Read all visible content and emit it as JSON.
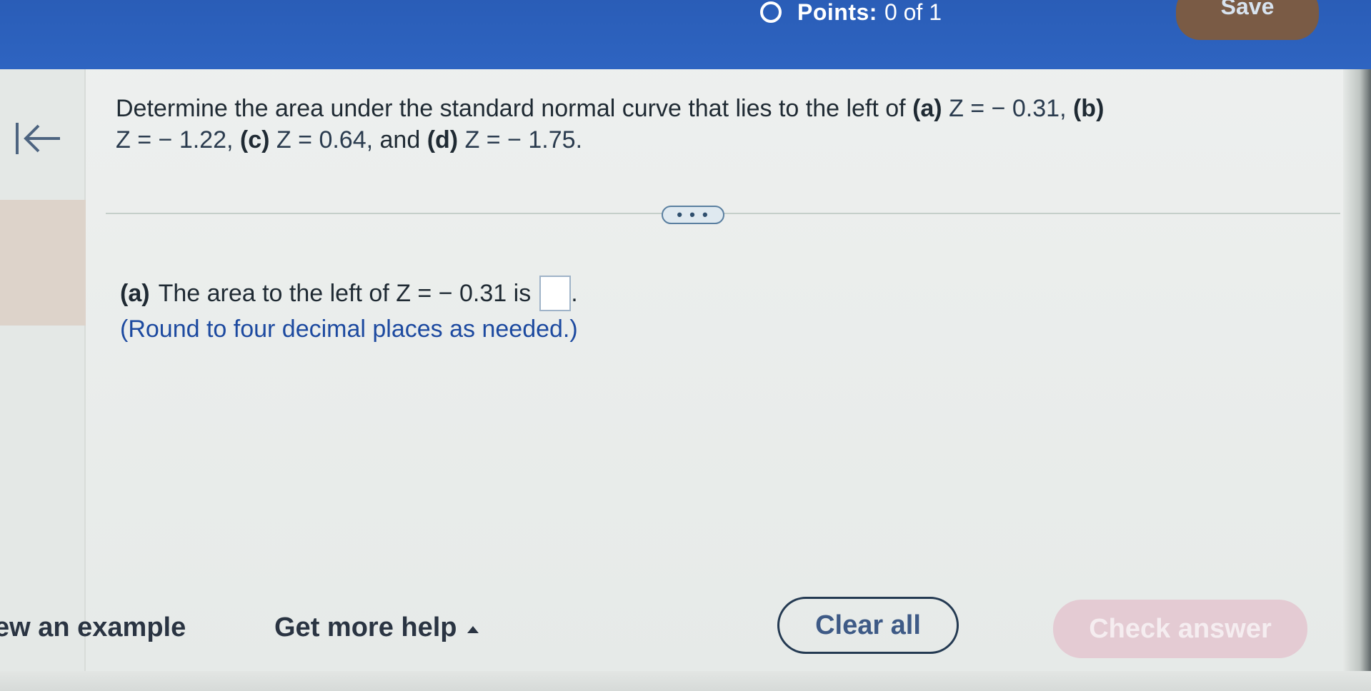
{
  "header": {
    "points_label": "Points:",
    "points_value": "0 of 1",
    "save_label": "Save"
  },
  "question": {
    "line1_prefix": "Determine the area under the standard normal curve that lies to the left of ",
    "a_tag": "(a)",
    "a_expr": "Z = − 0.31,",
    "b_tag": "(b)",
    "b_expr": "Z = − 1.22,",
    "c_tag": "(c)",
    "c_expr": "Z = 0.64,",
    "and_word": "and",
    "d_tag": "(d)",
    "d_expr": "Z = − 1.75."
  },
  "expand_button": "• • •",
  "part_a": {
    "tag": "(a)",
    "text": "The area to the left of Z = − 0.31 is",
    "period": ".",
    "answer_value": "",
    "note": "(Round to four decimal places as needed.)"
  },
  "footer": {
    "view_example": "ew an example",
    "get_more_help": "Get more help",
    "clear_all": "Clear all",
    "check_answer": "Check answer"
  },
  "colors": {
    "header_blue": "#2e64c1",
    "note_blue": "#1d4aa0",
    "check_answer_disabled": "#e4cbd3"
  }
}
